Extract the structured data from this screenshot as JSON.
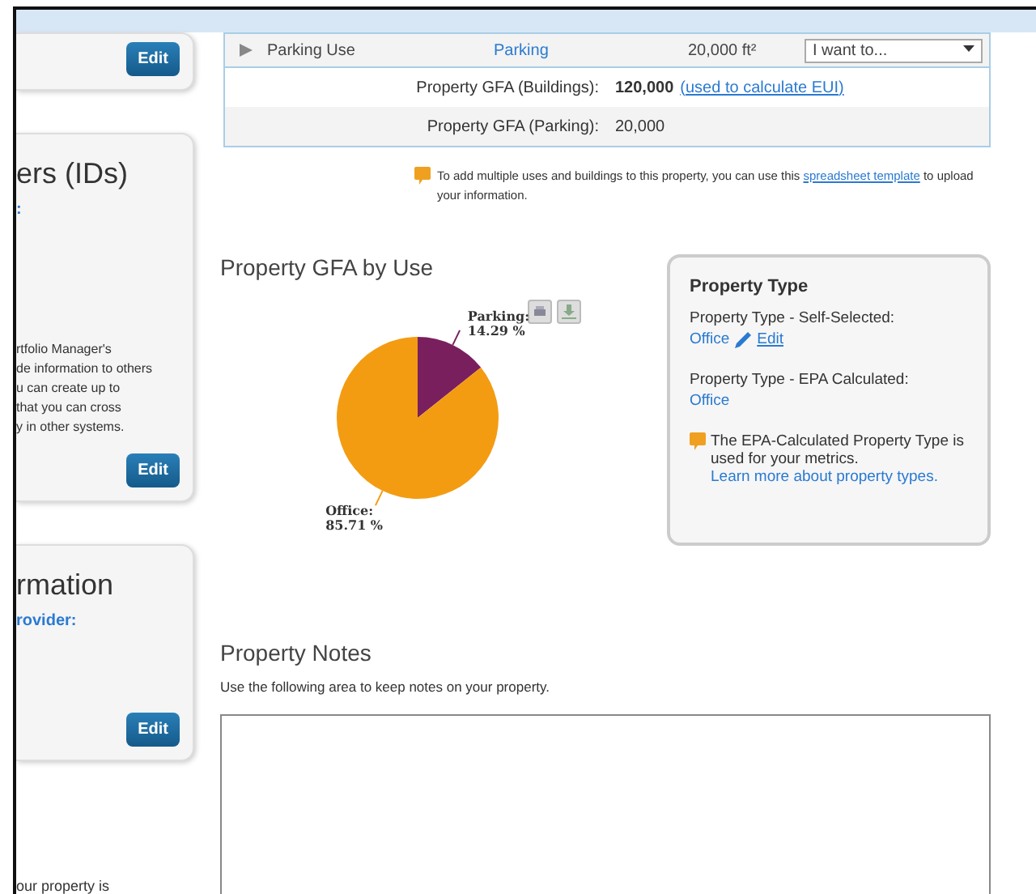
{
  "sidebar": {
    "cards": [
      {
        "button": "Edit"
      },
      {
        "heading": "ers (IDs)",
        "link": ":",
        "lines": [
          "rtfolio Manager's",
          "de information to others",
          "u can create up to",
          "that you can cross",
          "y in other systems."
        ],
        "button": "Edit"
      },
      {
        "heading": "rmation",
        "link": "rovider:",
        "button": "Edit"
      }
    ],
    "trailing_text": "our property is"
  },
  "uses_table": {
    "row": {
      "name": "Parking Use",
      "type": "Parking",
      "area": "20,000 ft²",
      "action": "I want to..."
    },
    "totals": [
      {
        "label": "Property GFA (Buildings):",
        "value": "120,000",
        "link": "(used to calculate EUI)"
      },
      {
        "label": "Property GFA (Parking):",
        "value": "20,000"
      }
    ]
  },
  "tip": {
    "text": "To add multiple uses and buildings to this property, you can use this ",
    "link": "spreadsheet template",
    "tail": " to upload your information."
  },
  "gfa_chart": {
    "title": "Property GFA by Use",
    "label_separator": ":",
    "chart_data": {
      "type": "pie",
      "categories": [
        "Parking",
        "Office"
      ],
      "series": [
        {
          "values": [
            14.29,
            85.71
          ]
        }
      ],
      "value_labels": [
        "14.29 %",
        "85.71 %"
      ]
    }
  },
  "property_type": {
    "title": "Property Type",
    "self_label": "Property Type - Self-Selected:",
    "self_value": "Office",
    "edit": "Edit",
    "epa_label": "Property Type - EPA Calculated:",
    "epa_value": "Office",
    "note": "The EPA-Calculated Property Type is used for your metrics. ",
    "note_link": "Learn more about property types."
  },
  "notes": {
    "title": "Property Notes",
    "hint": "Use the following area to keep notes on your property."
  }
}
